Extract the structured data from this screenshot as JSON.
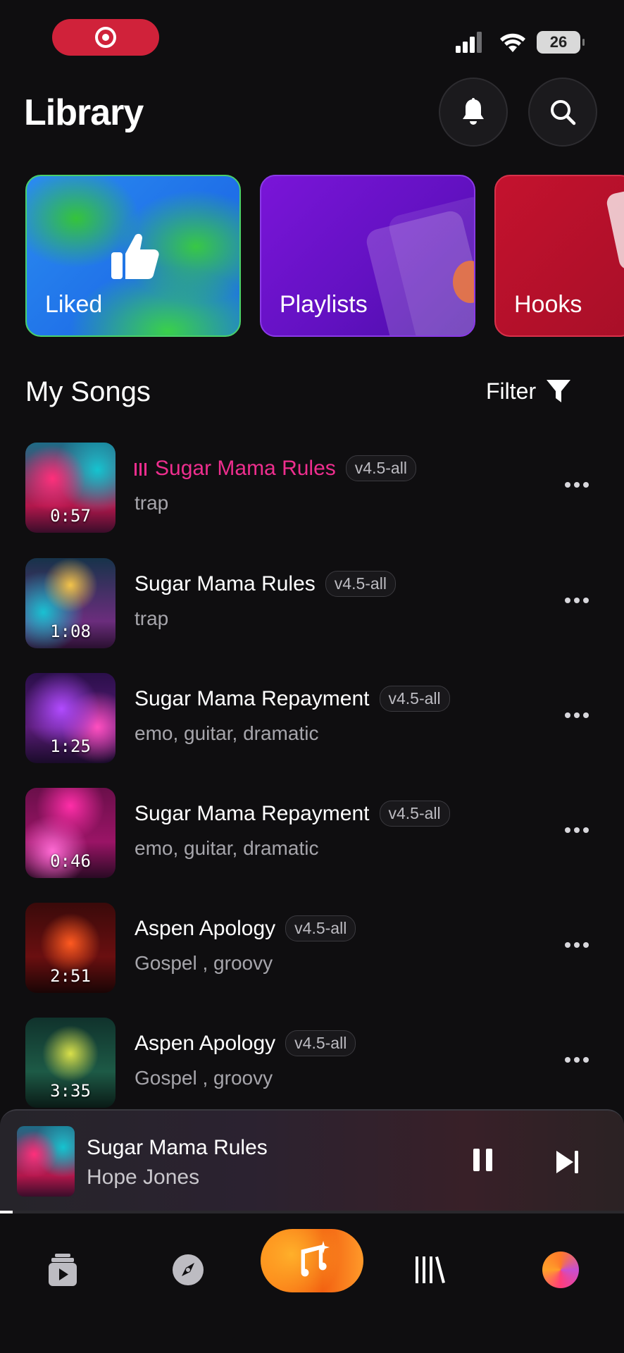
{
  "status_bar": {
    "battery": "26"
  },
  "header": {
    "title": "Library"
  },
  "cards": [
    {
      "label": "Liked"
    },
    {
      "label": "Playlists"
    },
    {
      "label": "Hooks"
    }
  ],
  "section": {
    "title": "My Songs",
    "filter_label": "Filter"
  },
  "songs": [
    {
      "title": "Sugar Mama Rules",
      "version": "v4.5-all",
      "genre": "trap",
      "duration": "0:57",
      "playing": true
    },
    {
      "title": "Sugar Mama Rules",
      "version": "v4.5-all",
      "genre": "trap",
      "duration": "1:08"
    },
    {
      "title": "Sugar Mama Repayment",
      "version": "v4.5-all",
      "genre": "emo, guitar, dramatic",
      "duration": "1:25"
    },
    {
      "title": "Sugar Mama Repayment",
      "version": "v4.5-all",
      "genre": "emo, guitar, dramatic",
      "duration": "0:46"
    },
    {
      "title": "Aspen Apology",
      "version": "v4.5-all",
      "genre": "Gospel , groovy",
      "duration": "2:51"
    },
    {
      "title": "Aspen Apology",
      "version": "v4.5-all",
      "genre": "Gospel , groovy",
      "duration": "3:35"
    }
  ],
  "player": {
    "title": "Sugar Mama Rules",
    "artist": "Hope Jones",
    "progress": 0.02
  },
  "tabs": [
    {
      "icon": "play-stack-icon"
    },
    {
      "icon": "compass-icon"
    },
    {
      "icon": "create-music-icon"
    },
    {
      "icon": "library-icon"
    },
    {
      "icon": "profile-avatar"
    }
  ],
  "colors": {
    "accent": "#ee2e8e",
    "create": "#f57a1a",
    "background": "#0f0e10"
  }
}
